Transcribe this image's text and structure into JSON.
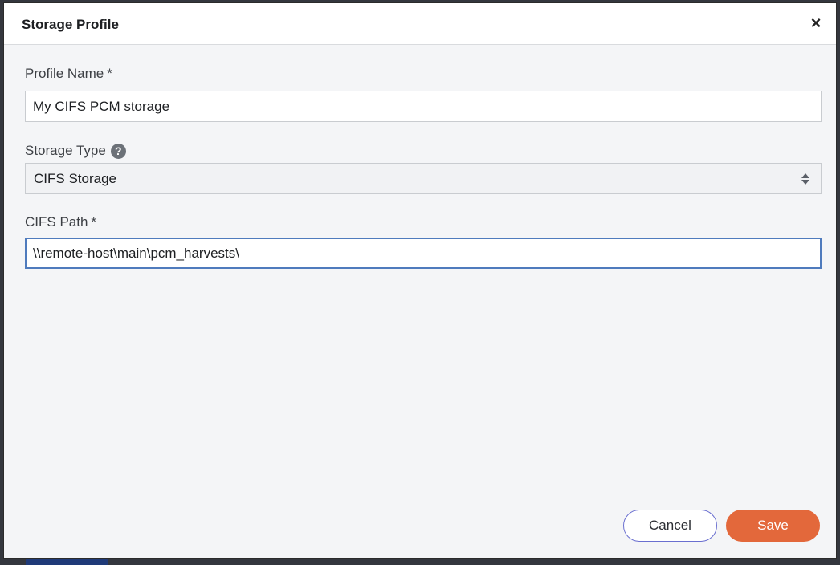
{
  "dialog": {
    "title": "Storage Profile",
    "close_icon": "×"
  },
  "form": {
    "profile_name": {
      "label": "Profile Name",
      "required_mark": "*",
      "value": "My CIFS PCM storage"
    },
    "storage_type": {
      "label": "Storage Type",
      "help_icon": "?",
      "selected": "CIFS Storage"
    },
    "cifs_path": {
      "label": "CIFS Path",
      "required_mark": "*",
      "value": "\\\\remote-host\\main\\pcm_harvests\\"
    }
  },
  "footer": {
    "cancel_label": "Cancel",
    "save_label": "Save"
  },
  "colors": {
    "accent_save": "#e3683b",
    "cancel_border": "#6a6fd0",
    "focus_border": "#4f7bbd"
  },
  "icons": {
    "close": "close-icon",
    "help": "help-icon",
    "select": "select-arrows-icon"
  }
}
